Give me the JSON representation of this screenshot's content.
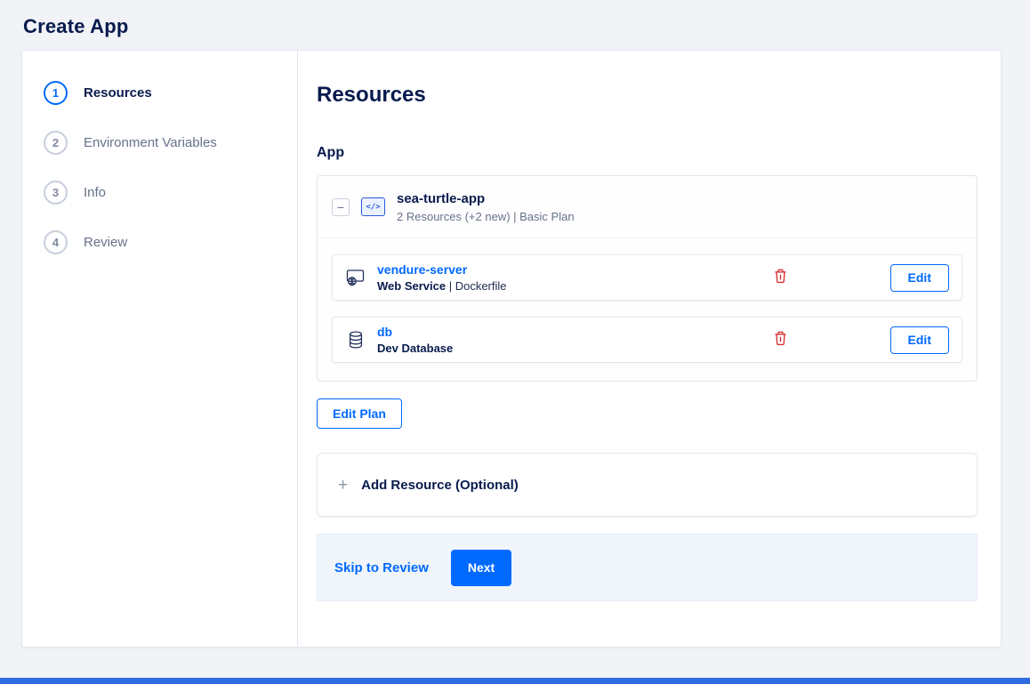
{
  "page": {
    "title": "Create App"
  },
  "stepper": {
    "steps": [
      {
        "number": "1",
        "label": "Resources",
        "active": true
      },
      {
        "number": "2",
        "label": "Environment Variables",
        "active": false
      },
      {
        "number": "3",
        "label": "Info",
        "active": false
      },
      {
        "number": "4",
        "label": "Review",
        "active": false
      }
    ]
  },
  "icons": {
    "minus": "−",
    "code": "</>",
    "plus": "+"
  },
  "content": {
    "heading": "Resources",
    "app_section": {
      "label": "App",
      "app_name": "sea-turtle-app",
      "app_subtitle": "2 Resources (+2 new) | Basic Plan",
      "resources": [
        {
          "name": "vendure-server",
          "detail_bold": "Web Service",
          "detail_rest": " | Dockerfile",
          "icon": "web-service-icon",
          "edit_label": "Edit"
        },
        {
          "name": "db",
          "detail_bold": "Dev Database",
          "detail_rest": "",
          "icon": "database-icon",
          "edit_label": "Edit"
        }
      ]
    },
    "edit_plan_label": "Edit Plan",
    "add_resource_label": "Add Resource (Optional)",
    "footer": {
      "skip_label": "Skip to Review",
      "next_label": "Next"
    }
  },
  "colors": {
    "accent": "#0069ff",
    "heading_text": "#081b4e",
    "muted_text": "#66718a",
    "danger": "#d63434",
    "footer_bg": "#eff5fb",
    "bottom_bar": "#2e6ce0"
  }
}
